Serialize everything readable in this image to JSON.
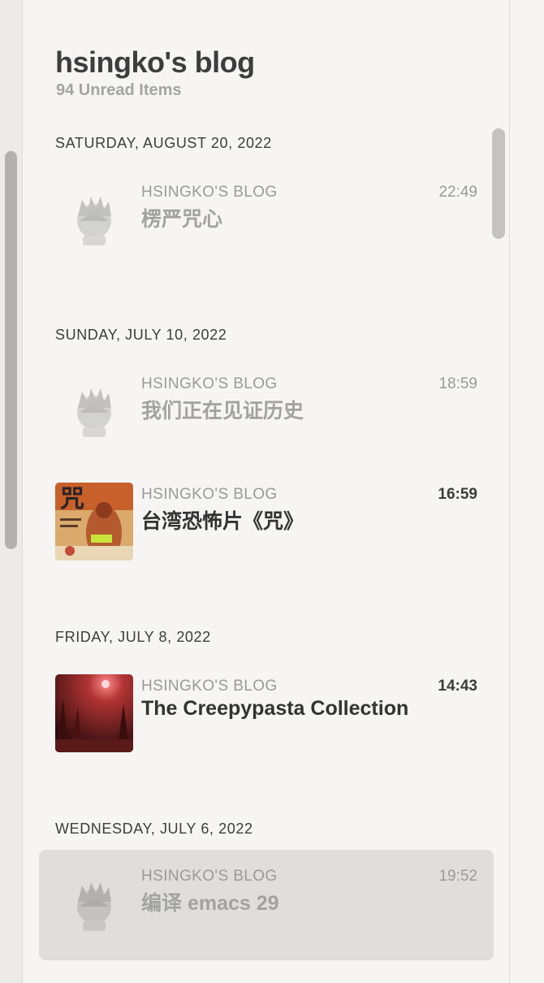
{
  "header": {
    "title": "hsingko's blog",
    "subtitle": "94 Unread Items"
  },
  "groups": [
    {
      "date": "SATURDAY, AUGUST 20, 2022",
      "items": [
        {
          "feed": "HSINGKO'S BLOG",
          "time": "22:49",
          "title": "楞严咒心",
          "thumb": "avatar-icon",
          "read": true
        }
      ]
    },
    {
      "date": "SUNDAY, JULY 10, 2022",
      "items": [
        {
          "feed": "HSINGKO'S BLOG",
          "time": "18:59",
          "title": "我们正在见证历史",
          "thumb": "avatar-icon",
          "read": true
        },
        {
          "feed": "HSINGKO'S BLOG",
          "time": "16:59",
          "title": "台湾恐怖片《咒》",
          "thumb": "movie-poster-thumbnail",
          "read": false
        }
      ]
    },
    {
      "date": "FRIDAY, JULY 8, 2022",
      "items": [
        {
          "feed": "HSINGKO'S BLOG",
          "time": "14:43",
          "title": "The Creepypasta Collection",
          "thumb": "red-forest-thumbnail",
          "read": false
        }
      ]
    },
    {
      "date": "WEDNESDAY, JULY 6, 2022",
      "items": [
        {
          "feed": "HSINGKO'S BLOG",
          "time": "19:52",
          "title": "编译 emacs 29",
          "thumb": "avatar-icon",
          "read": true,
          "selected": true
        }
      ]
    }
  ],
  "colors": {
    "background": "#f6f5f3",
    "selected": "#dfdedc",
    "muted_text": "#9a9a98",
    "strong_text": "#3d3d3d"
  }
}
